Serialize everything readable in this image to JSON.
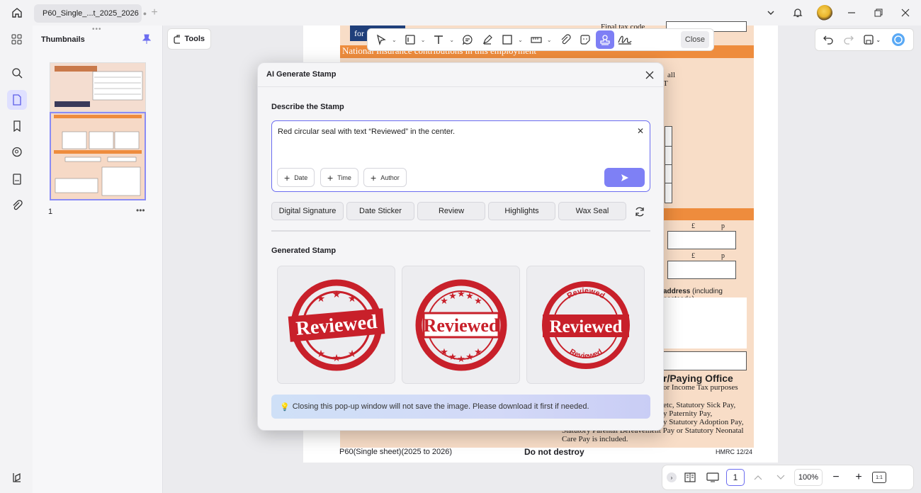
{
  "tab": {
    "title": "P60_Single_...t_2025_2026"
  },
  "thumbnails": {
    "title": "Thumbnails",
    "page_number": "1"
  },
  "tools": {
    "label": "Tools"
  },
  "toolbar": {
    "close_label": "Close"
  },
  "document": {
    "tax_code_label": "Final tax code",
    "for_text": "for",
    "ni_heading": "National Insurance contributions in this employment",
    "all_text": "all",
    "t_text": "T",
    "pound1": "£",
    "pence1": "p",
    "pound2": "£",
    "pence2": "p",
    "address_bold": "address",
    "address_rest": " (including postcode)",
    "paying_office": "r/Paying Office",
    "income_tax": "or Income Tax purposes",
    "lines": [
      "etc, Statutory Sick Pay,",
      "y Paternity Pay,",
      "y Statutory Adoption Pay,",
      "Statutory Parental Bereavement Pay or Statutory Neonatal",
      "Care Pay is included."
    ],
    "footer_left": "P60(Single sheet)(2025 to 2026)",
    "footer_mid": "Do not destroy",
    "footer_right": "HMRC 12/24"
  },
  "dialog": {
    "title": "AI Generate Stamp",
    "describe_label": "Describe the Stamp",
    "prompt_value": "Red circular seal with text “Reviewed” in the center.",
    "chips": [
      "Date",
      "Time",
      "Author"
    ],
    "presets": [
      "Digital Signature",
      "Date Sticker",
      "Review",
      "Highlights",
      "Wax Seal"
    ],
    "generated_label": "Generated Stamp",
    "stamp_text": "Reviewed",
    "notice": "Closing this pop-up window will not save the image. Please download it first if needed."
  },
  "bottom": {
    "page": "1",
    "zoom": "100%",
    "fit": "1:1"
  },
  "colors": {
    "accent": "#6b6cf0",
    "stamp_red": "#c8202a",
    "form_orange": "#ee8c3d"
  }
}
